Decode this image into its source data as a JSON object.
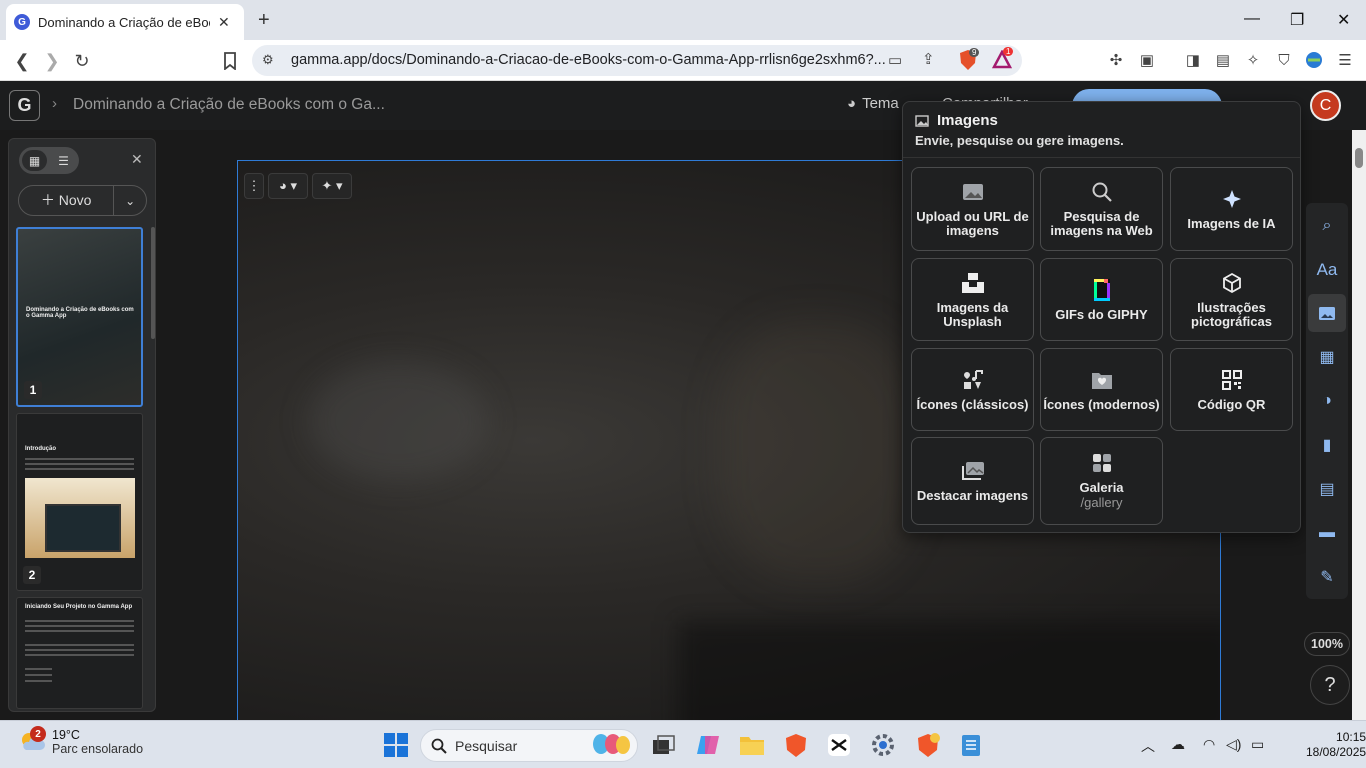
{
  "browser": {
    "tab_title": "Dominando a Criação de eBooks",
    "url": "gamma.app/docs/Dominando-a-Criacao-de-eBooks-com-o-Gamma-App-rrlisn6ge2sxhm6?...",
    "brave_shield_count": "9",
    "brave_rewards_count": "1"
  },
  "app": {
    "logo": "G",
    "doc_title": "Dominando a Criação de eBooks com o Ga...",
    "theme_label": "Tema",
    "share_label": "Compartilhar",
    "avatar_initial": "C"
  },
  "left_panel": {
    "new_label": "Novo",
    "slides": [
      {
        "number": "1",
        "title": "Dominando a Criação de eBooks com o Gamma App"
      },
      {
        "number": "2",
        "title": "Introdução"
      },
      {
        "number": "3",
        "title": "Iniciando Seu Projeto no Gamma App"
      }
    ]
  },
  "popover": {
    "title": "Imagens",
    "subtitle": "Envie, pesquise ou gere imagens.",
    "options": [
      {
        "label": "Upload ou URL de imagens",
        "icon": "image-icon"
      },
      {
        "label": "Pesquisa de imagens na Web",
        "icon": "search-icon"
      },
      {
        "label": "Imagens de IA",
        "icon": "sparkle-icon"
      },
      {
        "label": "Imagens da Unsplash",
        "icon": "unsplash-icon"
      },
      {
        "label": "GIFs do GIPHY",
        "icon": "giphy-icon"
      },
      {
        "label": "Ilustrações pictográficas",
        "icon": "cube-icon"
      },
      {
        "label": "Ícones (clássicos)",
        "icon": "classic-icons-icon"
      },
      {
        "label": "Ícones (modernos)",
        "icon": "heart-folder-icon"
      },
      {
        "label": "Código QR",
        "icon": "qr-icon"
      },
      {
        "label": "Destacar imagens",
        "icon": "images-stack-icon"
      },
      {
        "label": "Galeria",
        "sub": "/gallery",
        "icon": "grid-icon"
      }
    ]
  },
  "zoom": "100%",
  "help": "?",
  "taskbar": {
    "weather_temp": "19°C",
    "weather_desc": "Parc ensolarado",
    "weather_badge": "2",
    "search_placeholder": "Pesquisar",
    "time": "10:15",
    "date": "18/08/2025"
  }
}
